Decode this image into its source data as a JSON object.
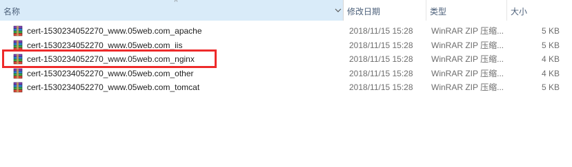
{
  "header": {
    "name_label": "名称",
    "date_label": "修改日期",
    "type_label": "类型",
    "size_label": "大小",
    "sort_indicator": "^"
  },
  "files": [
    {
      "name": "cert-1530234052270_www.05web.com_apache",
      "date": "2018/11/15 15:28",
      "type": "WinRAR ZIP 压缩...",
      "size": "5 KB"
    },
    {
      "name": "cert-1530234052270_www.05web.com_iis",
      "date": "2018/11/15 15:28",
      "type": "WinRAR ZIP 压缩...",
      "size": "5 KB"
    },
    {
      "name": "cert-1530234052270_www.05web.com_nginx",
      "date": "2018/11/15 15:28",
      "type": "WinRAR ZIP 压缩...",
      "size": "4 KB"
    },
    {
      "name": "cert-1530234052270_www.05web.com_other",
      "date": "2018/11/15 15:28",
      "type": "WinRAR ZIP 压缩...",
      "size": "4 KB"
    },
    {
      "name": "cert-1530234052270_www.05web.com_tomcat",
      "date": "2018/11/15 15:28",
      "type": "WinRAR ZIP 压缩...",
      "size": "5 KB"
    }
  ],
  "icons": {
    "file": "winrar-archive-icon",
    "sort": "sort-ascending-icon",
    "chevron": "chevron-down-icon"
  },
  "colors": {
    "header_selected": "#d9ebf9",
    "header_text": "#4c607a",
    "highlight_border": "#ee2a2a"
  }
}
